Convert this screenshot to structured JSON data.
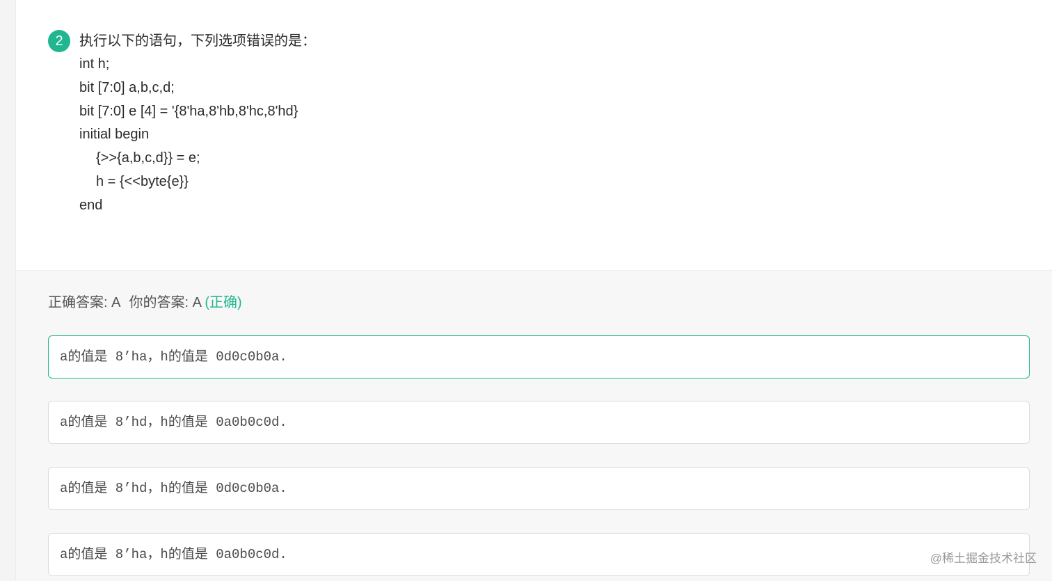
{
  "question": {
    "number": "2",
    "title": "执行以下的语句，下列选项错误的是：",
    "code_lines": [
      {
        "text": "int h;",
        "indent": false
      },
      {
        "text": "bit [7:0] a,b,c,d;",
        "indent": false
      },
      {
        "text": "bit [7:0] e [4] = '{8'ha,8'hb,8'hc,8'hd}",
        "indent": false
      },
      {
        "text": "initial begin",
        "indent": false
      },
      {
        "text": "{>>{a,b,c,d}} = e;",
        "indent": true
      },
      {
        "text": "h = {<<byte{e}}",
        "indent": true
      },
      {
        "text": "end",
        "indent": false
      }
    ]
  },
  "answer": {
    "correct_label": "正确答案: A",
    "yours_label": "你的答案: A",
    "result": "(正确)"
  },
  "options": [
    {
      "text": "a的值是 8’ha，h的值是 0d0c0b0a.",
      "selected": true
    },
    {
      "text": "a的值是 8’hd，h的值是 0a0b0c0d.",
      "selected": false
    },
    {
      "text": "a的值是 8’hd，h的值是 0d0c0b0a.",
      "selected": false
    },
    {
      "text": "a的值是 8’ha，h的值是 0a0b0c0d.",
      "selected": false
    }
  ],
  "watermark": "@稀土掘金技术社区",
  "colors": {
    "accent": "#21b68f",
    "answer_bg": "#f7f7f7",
    "text": "#2b2b2b"
  }
}
